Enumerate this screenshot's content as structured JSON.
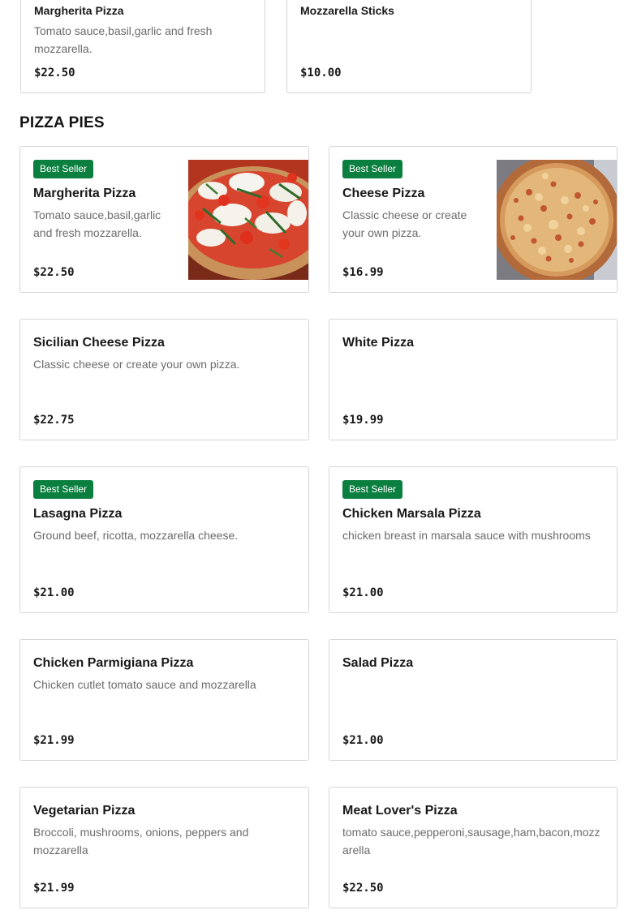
{
  "top_cards": [
    {
      "name": "Margherita Pizza",
      "description": "Tomato sauce,basil,garlic and fresh mozzarella.",
      "price": "$22.50"
    },
    {
      "name": "Mozzarella Sticks",
      "description": "",
      "price": "$10.00"
    }
  ],
  "section": {
    "title": "PIZZA PIES"
  },
  "items": [
    {
      "badge": "Best Seller",
      "name": "Margherita Pizza",
      "description": "Tomato sauce,basil,garlic and fresh mozzarella.",
      "price": "$22.50",
      "image": "margherita-pizza-photo"
    },
    {
      "badge": "Best Seller",
      "name": "Cheese Pizza",
      "description": "Classic cheese or create your own pizza.",
      "price": "$16.99",
      "image": "cheese-pizza-photo"
    },
    {
      "badge": "",
      "name": "Sicilian Cheese Pizza",
      "description": "Classic cheese or create your own pizza.",
      "price": "$22.75"
    },
    {
      "badge": "",
      "name": "White Pizza",
      "description": "",
      "price": "$19.99"
    },
    {
      "badge": "Best Seller",
      "name": "Lasagna Pizza",
      "description": "Ground beef, ricotta, mozzarella cheese.",
      "price": "$21.00"
    },
    {
      "badge": "Best Seller",
      "name": "Chicken Marsala Pizza",
      "description": "chicken breast in marsala sauce with mushrooms",
      "price": "$21.00"
    },
    {
      "badge": "",
      "name": "Chicken Parmigiana Pizza",
      "description": "Chicken cutlet tomato sauce and mozzarella",
      "price": "$21.99"
    },
    {
      "badge": "",
      "name": "Salad Pizza",
      "description": "",
      "price": "$21.00"
    },
    {
      "badge": "",
      "name": "Vegetarian Pizza",
      "description": "Broccoli, mushrooms, onions, peppers and mozzarella",
      "price": "$21.99"
    },
    {
      "badge": "",
      "name": "Meat Lover's Pizza",
      "description": "tomato sauce,pepperoni,sausage,ham,bacon,mozzarella",
      "price": "$22.50"
    }
  ],
  "colors": {
    "badge_bg": "#0a7f3f",
    "border": "#d6d6d6",
    "text": "#191919",
    "muted": "#6b6b6b"
  }
}
